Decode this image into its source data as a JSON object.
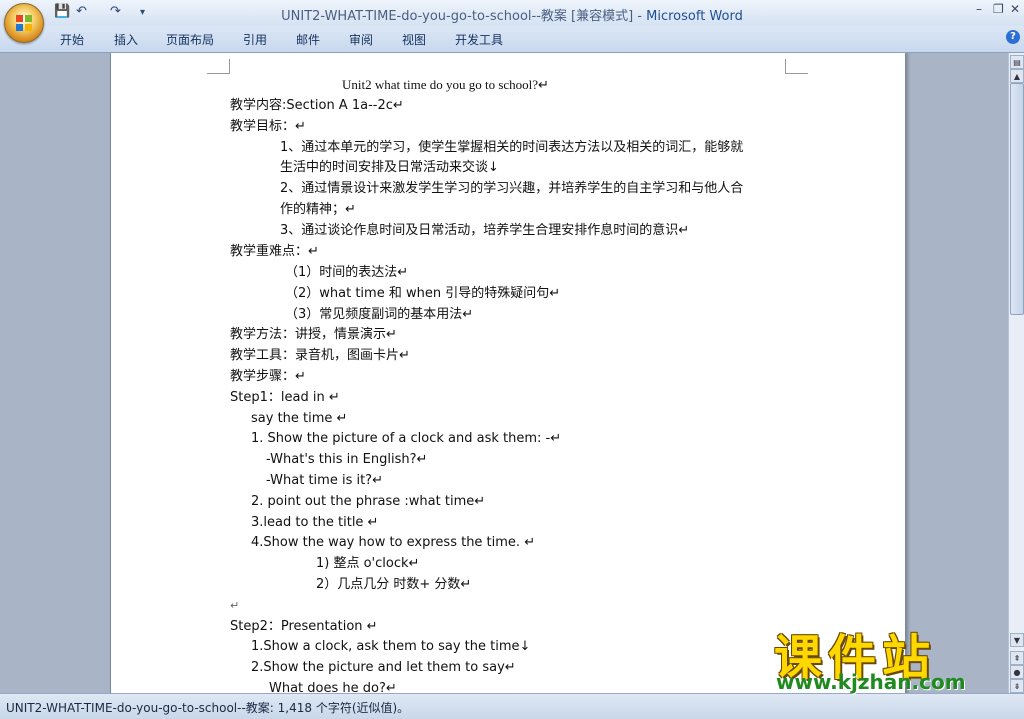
{
  "window": {
    "title_doc": "UNIT2-WHAT-TIME-do-you-go-to-school--教案 [兼容模式] - ",
    "title_app": "Microsoft Word",
    "minimize": "–",
    "restore": "❐",
    "close": "✕"
  },
  "quick_access": {
    "save": "💾",
    "undo": "↶",
    "redo": "↷",
    "customize": "▾"
  },
  "ribbon": {
    "tabs": [
      "开始",
      "插入",
      "页面布局",
      "引用",
      "邮件",
      "审阅",
      "视图",
      "开发工具"
    ],
    "help": "?"
  },
  "document": {
    "lines": [
      "Unit2 what time do you go to school?↵",
      "教学内容:Section A 1a--2c↵",
      "教学目标：↵",
      "1、通过本单元的学习，使学生掌握相关的时间表达方法以及相关的词汇，能够就",
      "生活中的时间安排及日常活动来交谈↓",
      "2、通过情景设计来激发学生学习的学习兴趣，并培养学生的自主学习和与他人合",
      "作的精神；↵",
      "3、通过谈论作息时间及日常活动，培养学生合理安排作息时间的意识↵",
      "教学重难点：↵",
      "（1）时间的表达法↵",
      "（2）what time  和 when 引导的特殊疑问句↵",
      "（3）常见频度副词的基本用法↵",
      "教学方法：讲授，情景演示↵",
      "教学工具：录音机，图画卡片↵",
      "教学步骤：↵",
      "Step1：lead in    ↵",
      "say   the   time  ↵",
      "1. Show the  picture  of  a clock and ask them: -↵",
      "-What's this in English?↵",
      "-What time is it?↵",
      "2.  point  out  the  phrase  :what  time↵",
      "3.lead  to  the  title  ↵",
      "4.Show the way how to express the time.  ↵",
      "1) 整点        o'clock↵",
      "2）几点几分     时数+ 分数↵",
      "↵",
      "Step2：Presentation      ↵",
      "1.Show a clock,   ask them to say the time↓",
      "2.Show the picture and let them to say↵",
      "What does he do?↵"
    ]
  },
  "status": {
    "text": "UNIT2-WHAT-TIME-do-you-go-to-school--教案: 1,418 个字符(近似值)。"
  },
  "watermark": {
    "title": "课件站",
    "url": "www.kjzhan.com"
  },
  "colors": {
    "accent": "#1e4e96",
    "workspace": "#a9b5c7",
    "watermark_yellow": "#ffd800",
    "watermark_green": "#1f8a1f"
  }
}
